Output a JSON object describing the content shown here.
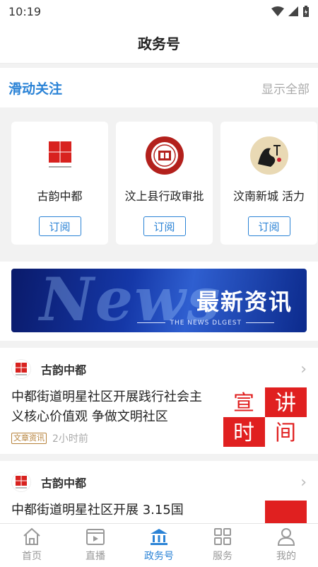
{
  "status_bar": {
    "time": "10:19"
  },
  "header": {
    "title": "政务号"
  },
  "follow": {
    "title": "滑动关注",
    "show_all": "显示全部"
  },
  "cards": [
    {
      "name": "古韵中都",
      "subscribe": "订阅"
    },
    {
      "name": "汶上县行政审批",
      "subscribe": "订阅"
    },
    {
      "name": "汶南新城  活力",
      "subscribe": "订阅"
    }
  ],
  "banner": {
    "title": "最新资讯",
    "subtitle": "THE NEWS DLGEST",
    "bg_text": "News"
  },
  "articles": [
    {
      "source": "古韵中都",
      "title": "中都街道明星社区开展践行社会主义核心价值观    争做文明社区",
      "tag": "文章资讯",
      "time": "2小时前"
    },
    {
      "source": "古韵中都",
      "title": "中都街道明星社区开展  3.15国",
      "tag": "",
      "time": ""
    }
  ],
  "thumb_text": [
    "宣",
    "讲",
    "时",
    "间"
  ],
  "nav": [
    {
      "label": "首页",
      "icon": "home-icon"
    },
    {
      "label": "直播",
      "icon": "video-icon"
    },
    {
      "label": "政务号",
      "icon": "government-icon"
    },
    {
      "label": "服务",
      "icon": "grid-icon"
    },
    {
      "label": "我的",
      "icon": "user-icon"
    }
  ],
  "colors": {
    "accent": "#2b83d6",
    "tag": "#b6813a",
    "thumb_red": "#e02020"
  }
}
